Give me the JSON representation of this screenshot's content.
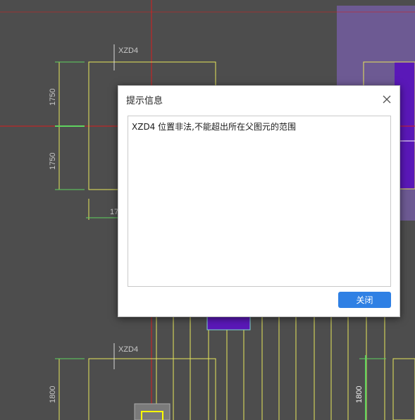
{
  "drawing": {
    "labels": {
      "xzd4_top": "XZD4",
      "xzd4_bottom": "XZD4",
      "dim_1750_a": "1750",
      "dim_1750_b": "1750",
      "dim_partial": "17",
      "dim_1800_left": "1800",
      "dim_1800_right": "1800"
    },
    "colors": {
      "background": "#4d4d4d",
      "outline_yellow": "#e6e65a",
      "dimension_line": "#5fd35f",
      "axis_red": "#d81e1e",
      "region_purple": "#6d5a93",
      "column_violet": "#5a18b8"
    }
  },
  "dialog": {
    "title": "提示信息",
    "close_icon": "close-icon",
    "message": "XZD4 位置非法,不能超出所在父图元的范围",
    "close_button_label": "关闭",
    "button_color": "#2f80e4"
  }
}
